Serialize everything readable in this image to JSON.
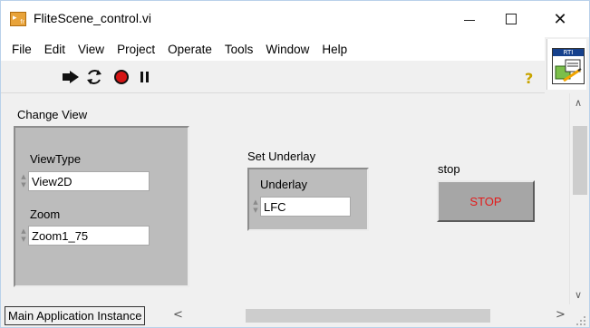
{
  "window": {
    "title": "FliteScene_control.vi"
  },
  "menu": {
    "items": [
      "File",
      "Edit",
      "View",
      "Project",
      "Operate",
      "Tools",
      "Window",
      "Help"
    ]
  },
  "toolbar": {
    "icons": [
      "run-arrow-icon",
      "run-continuously-icon",
      "abort-icon",
      "pause-icon",
      "help-icon"
    ],
    "help_glyph": "?",
    "rti_badge": "RTI"
  },
  "panel": {
    "change_view": {
      "label": "Change View",
      "view_type": {
        "label": "ViewType",
        "value": "View2D"
      },
      "zoom": {
        "label": "Zoom",
        "value": "Zoom1_75"
      }
    },
    "set_underlay": {
      "label": "Set Underlay",
      "underlay": {
        "label": "Underlay",
        "value": "LFC"
      }
    },
    "stop": {
      "label": "stop",
      "button_text": "STOP"
    }
  },
  "statusbar": {
    "instance": "Main Application Instance"
  },
  "colors": {
    "stop_text": "#e31b1b",
    "cluster_bg": "#bcbcbc",
    "window_bg": "#f0f0f0"
  }
}
